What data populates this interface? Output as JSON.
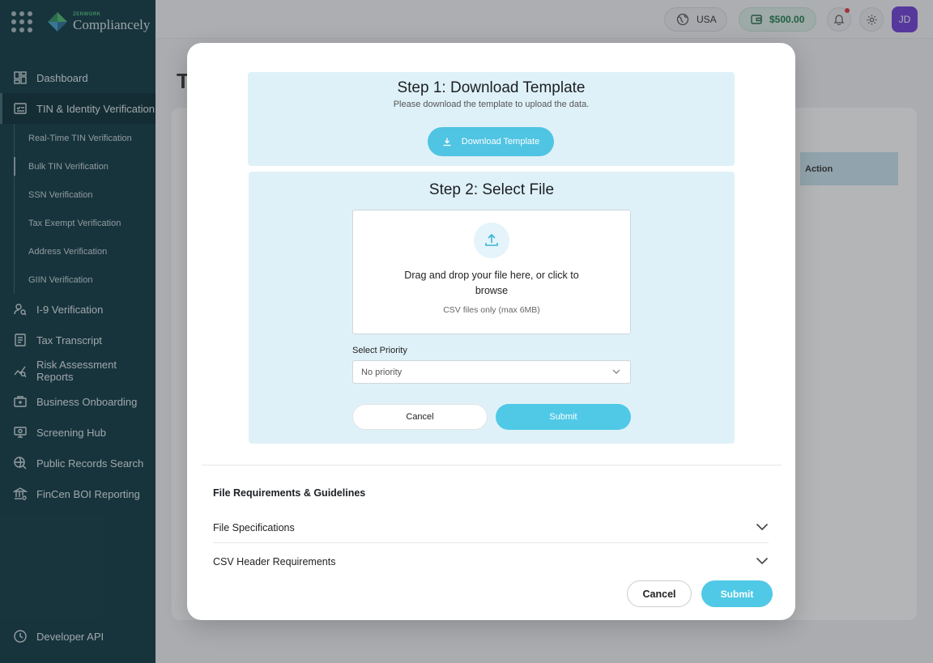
{
  "brand": {
    "small": "ZENWORK",
    "name": "Compliancely"
  },
  "sidebar": {
    "items": [
      {
        "label": "Dashboard",
        "icon": "dashboard-icon"
      },
      {
        "label": "TIN & Identity Verification",
        "icon": "checklist-icon"
      },
      {
        "label": "I-9 Verification",
        "icon": "person-search-icon"
      },
      {
        "label": "Tax Transcript",
        "icon": "document-icon"
      },
      {
        "label": "Risk Assessment Reports",
        "icon": "chart-icon"
      },
      {
        "label": "Business Onboarding",
        "icon": "onboarding-icon"
      },
      {
        "label": "Screening Hub",
        "icon": "monitor-icon"
      },
      {
        "label": "Public Records Search",
        "icon": "globe-search-icon"
      },
      {
        "label": "FinCen BOI Reporting",
        "icon": "bank-icon"
      }
    ],
    "sub_items": [
      "Real-Time TIN Verification",
      "Bulk TIN Verification",
      "SSN Verification",
      "Tax Exempt Verification",
      "Address Verification",
      "GIIN Verification"
    ],
    "developer_api": "Developer API"
  },
  "topbar": {
    "country": "USA",
    "wallet": "$500.00",
    "avatar": "JD"
  },
  "background": {
    "page_title": "T",
    "action_header": "Action"
  },
  "modal": {
    "step1": {
      "title": "Step 1: Download Template",
      "subtitle": "Please download the template to upload the data.",
      "download_label": "Download Template"
    },
    "step2": {
      "title": "Step 2: Select File",
      "drop_text": "Drag and drop your file here, or click to browse",
      "drop_hint": "CSV files only (max 6MB)",
      "priority_label": "Select Priority",
      "priority_value": "No priority",
      "cancel_label": "Cancel",
      "submit_label": "Submit"
    },
    "requirements": {
      "title": "File Requirements & Guidelines",
      "sections": [
        "File Specifications",
        "CSV Header Requirements"
      ]
    },
    "footer": {
      "cancel_label": "Cancel",
      "submit_label": "Submit"
    }
  },
  "colors": {
    "sidebar": "#0f3944",
    "accent": "#4fc9e6",
    "panel": "#dff1f8",
    "avatar": "#6f3fd8"
  }
}
